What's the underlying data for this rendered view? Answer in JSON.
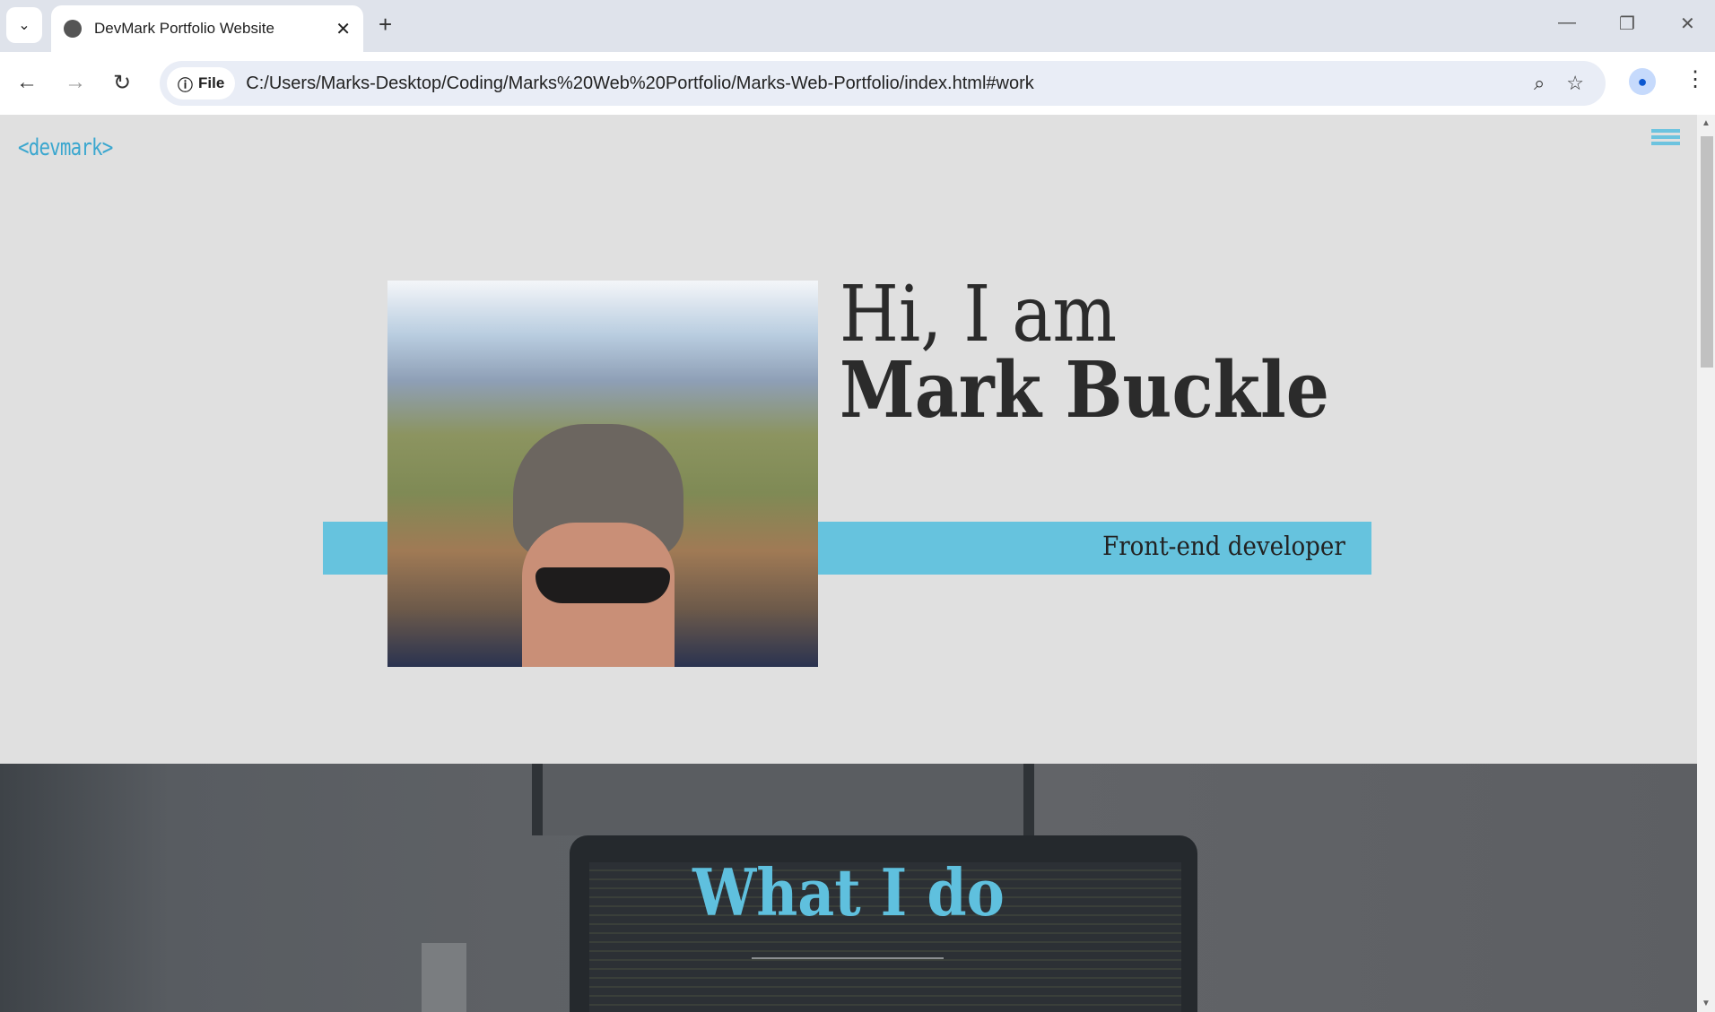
{
  "browser": {
    "tab_title": "DevMark Portfolio Website",
    "url_chip": "File",
    "url": "C:/Users/Marks-Desktop/Coding/Marks%20Web%20Portfolio/Marks-Web-Portfolio/index.html#work"
  },
  "page": {
    "logo": "<devmark>",
    "greeting": "Hi, I am",
    "name": "Mark Buckle",
    "role": "Front-end developer",
    "section_title": "What I do"
  },
  "colors": {
    "accent": "#66c3de",
    "heading": "#2b2b2b",
    "background": "#e0e0e0"
  }
}
